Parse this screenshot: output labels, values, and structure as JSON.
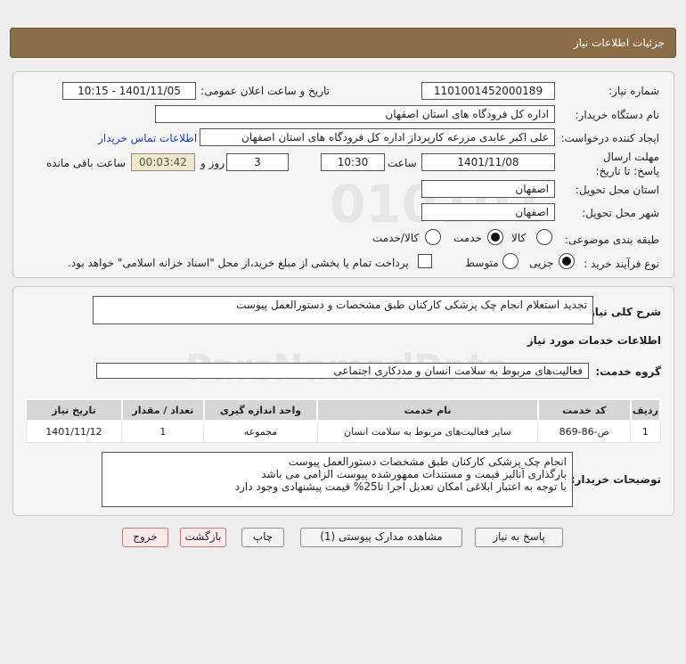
{
  "header": {
    "title": "جزئیات اطلاعات نیاز"
  },
  "form": {
    "need_number_label": "شماره نیاز:",
    "need_number": "1101001452000189",
    "announce_label": "تاریخ و ساعت اعلان عمومی:",
    "announce_value": "1401/11/05 - 10:15",
    "buyer_org_label": "نام دستگاه خریدار:",
    "buyer_org": "اداره کل فرودگاه های استان اصفهان",
    "creator_label": "ایجاد کننده درخواست:",
    "creator": "علی اکبر عابدی مزرعه کارپرداز اداره کل فرودگاه های استان اصفهان",
    "contact_link": "اطلاعات تماس خریدار",
    "deadline_label": "مهلت ارسال پاسخ: تا تاریخ:",
    "deadline_date": "1401/11/08",
    "time_label": "ساعت",
    "deadline_time": "10:30",
    "days_value": "3",
    "days_label": "روز و",
    "remaining_time": "00:03:42",
    "remaining_label": "ساعت باقی مانده",
    "province_label": "استان محل تحویل:",
    "province": "اصفهان",
    "city_label": "شهر محل تحویل:",
    "city": "اصفهان",
    "category_label": "طبقه بندی موضوعی:",
    "category_options": [
      "کالا",
      "خدمت",
      "کالا/خدمت"
    ],
    "process_label": "نوع فرآیند خرید :",
    "process_options": [
      "جزیی",
      "متوسط"
    ],
    "payment_note": "پرداخت تمام یا بخشی از مبلغ خرید،از محل \"اسناد خزانه اسلامی\" خواهد بود."
  },
  "details": {
    "summary_label": "شرح کلی نیاز:",
    "summary": "تجدید استعلام انجام چک پزشکی  کارکنان طبق مشخصات و دستورالعمل  پیوست",
    "services_title": "اطلاعات خدمات مورد نیاز",
    "service_group_label": "گروه خدمت:",
    "service_group": "فعالیت‌های مربوط به سلامت انسان و مددکاری اجتماعی",
    "table": {
      "headers": [
        "ردیف",
        "کد خدمت",
        "نام خدمت",
        "واحد اندازه گیری",
        "تعداد / مقدار",
        "تاریخ نیاز"
      ],
      "rows": [
        [
          "1",
          "ص-86-869",
          "سایر فعالیت‌های مربوط به سلامت انسان",
          "مجموعه",
          "1",
          "1401/11/12"
        ]
      ]
    },
    "buyer_notes_label": "توضیحات خریدار:",
    "buyer_notes": [
      "انجام چک پزشکی کارکنان  طبق مشخصات دستورالعمل  پیوست",
      "بارگذاری آنالیز قیمت و مستندات ممهورشده پیوست الزامی می باشد",
      "با توجه به اعتبار ابلاغی امکان تعدیل اجرا تا25% قیمت پیشنهادی وجود دارد"
    ]
  },
  "buttons": {
    "reply": "پاسخ به نیاز",
    "attachments": "مشاهده مدارک پیوستی (1)",
    "print": "چاپ",
    "back": "بازگشت",
    "exit": "خروج"
  },
  "watermark": {
    "brand": "ParsNamadData",
    "digits": "010101",
    "phone": "۰۲۱-"
  }
}
